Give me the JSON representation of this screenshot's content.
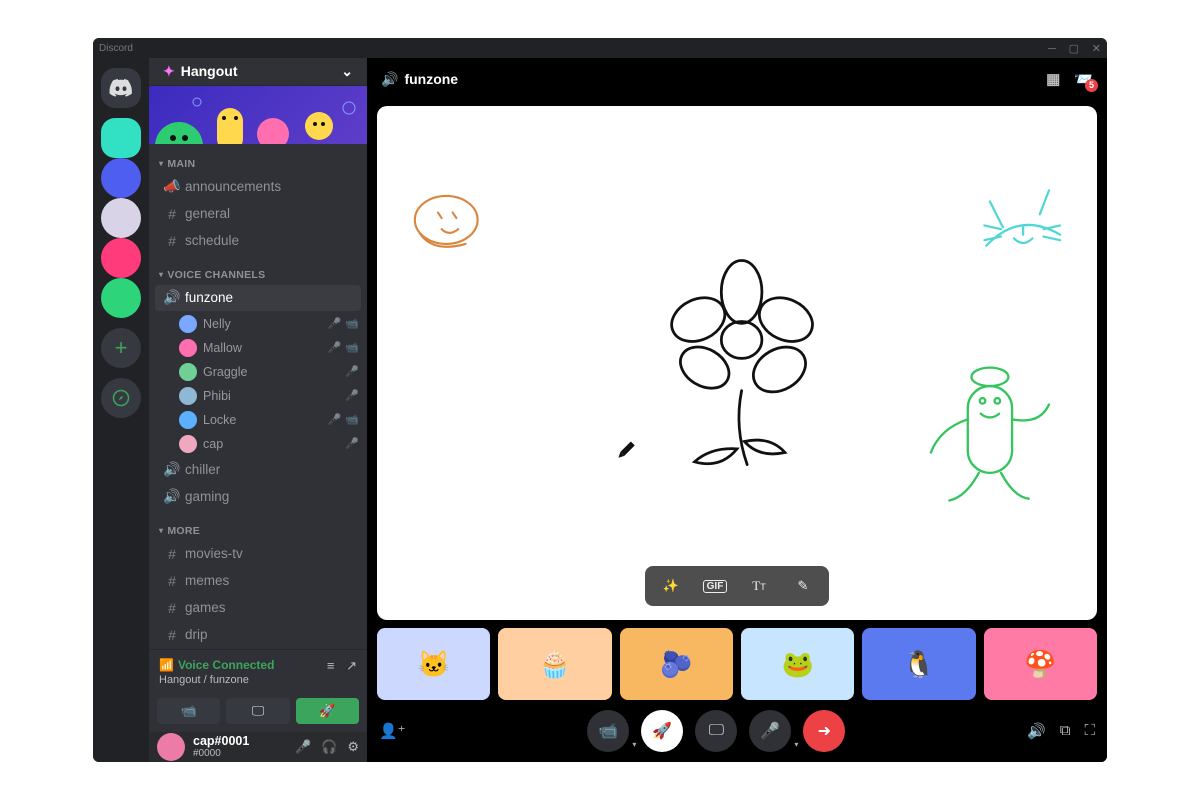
{
  "app": {
    "title": "Discord"
  },
  "server": {
    "name": "Hangout"
  },
  "header": {
    "channel": "funzone",
    "inbox_badge": "5"
  },
  "voice": {
    "status": "Voice Connected",
    "location": "Hangout / funzone"
  },
  "user": {
    "name": "cap#0001",
    "discriminator": "#0000"
  },
  "toolbar": {
    "gif": "GIF"
  },
  "rail_servers": [
    {
      "bg": "#32e0c4",
      "rounded": true
    },
    {
      "bg": "#4e5ef0"
    },
    {
      "bg": "#d8d3e6"
    },
    {
      "bg": "#ff3b7b"
    },
    {
      "bg": "#2ed47a"
    }
  ],
  "sections": [
    {
      "label": "MAIN",
      "channels": [
        {
          "name": "announcements",
          "icon": "megaphone"
        },
        {
          "name": "general",
          "icon": "hash"
        },
        {
          "name": "schedule",
          "icon": "hash"
        }
      ]
    },
    {
      "label": "VOICE CHANNELS",
      "channels": [
        {
          "name": "funzone",
          "icon": "speaker",
          "selected": true,
          "users": [
            {
              "name": "Nelly",
              "color": "#7aa7ff",
              "mic": true,
              "muted": false,
              "cam": true
            },
            {
              "name": "Mallow",
              "color": "#ff6fb0",
              "mic": true,
              "muted": true,
              "cam": true
            },
            {
              "name": "Graggle",
              "color": "#6fcf97",
              "mic": true,
              "muted": true,
              "cam": false
            },
            {
              "name": "Phibi",
              "color": "#8fb7d6",
              "mic": true,
              "muted": true,
              "cam": false
            },
            {
              "name": "Locke",
              "color": "#5bb0ff",
              "mic": true,
              "muted": false,
              "cam": true
            },
            {
              "name": "cap",
              "color": "#f0a8c0",
              "mic": true,
              "muted": true,
              "cam": false
            }
          ]
        },
        {
          "name": "chiller",
          "icon": "speaker"
        },
        {
          "name": "gaming",
          "icon": "speaker"
        }
      ]
    },
    {
      "label": "MORE",
      "channels": [
        {
          "name": "movies-tv",
          "icon": "hash"
        },
        {
          "name": "memes",
          "icon": "hash"
        },
        {
          "name": "games",
          "icon": "hash"
        },
        {
          "name": "drip",
          "icon": "hash"
        }
      ]
    }
  ],
  "tiles": [
    {
      "bg": "#cdd8ff"
    },
    {
      "bg": "#ffcfa1"
    },
    {
      "bg": "#f7b861"
    },
    {
      "bg": "#c8e5ff"
    },
    {
      "bg": "#5b7af0"
    },
    {
      "bg": "#ff7aa4"
    }
  ],
  "icons": {
    "hash": "#",
    "speaker": "🔊",
    "megaphone": "📣"
  }
}
